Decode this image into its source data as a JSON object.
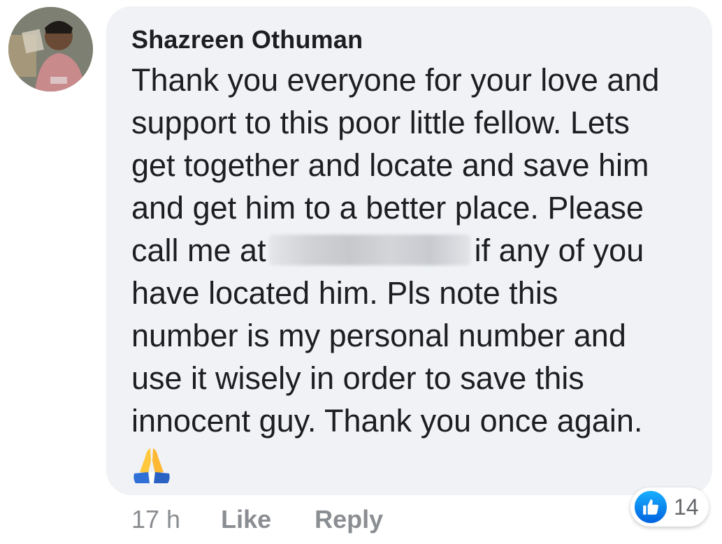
{
  "comment": {
    "author": "Shazreen Othuman",
    "text_lines": [
      "Thank you everyone for your love and",
      "support to this poor little fellow. Lets",
      "get together and locate and save him",
      "and get him to a better place. Please"
    ],
    "line_before_redaction": "call me at",
    "line_after_redaction": "if any of you",
    "text_lines_after": [
      "have located him. Pls note this",
      "number is my personal number and",
      "use it wisely in order to save this",
      "innocent guy. Thank you once again."
    ],
    "emoji": "folded-hands"
  },
  "actions": {
    "time": "17 h",
    "like_label": "Like",
    "reply_label": "Reply"
  },
  "reactions": {
    "count": "14",
    "icon": "like-icon"
  },
  "colors": {
    "bubble": "#f0f2f5",
    "text": "#1c1e21",
    "secondary": "#8a8d91",
    "like_blue": "#0571ed"
  }
}
